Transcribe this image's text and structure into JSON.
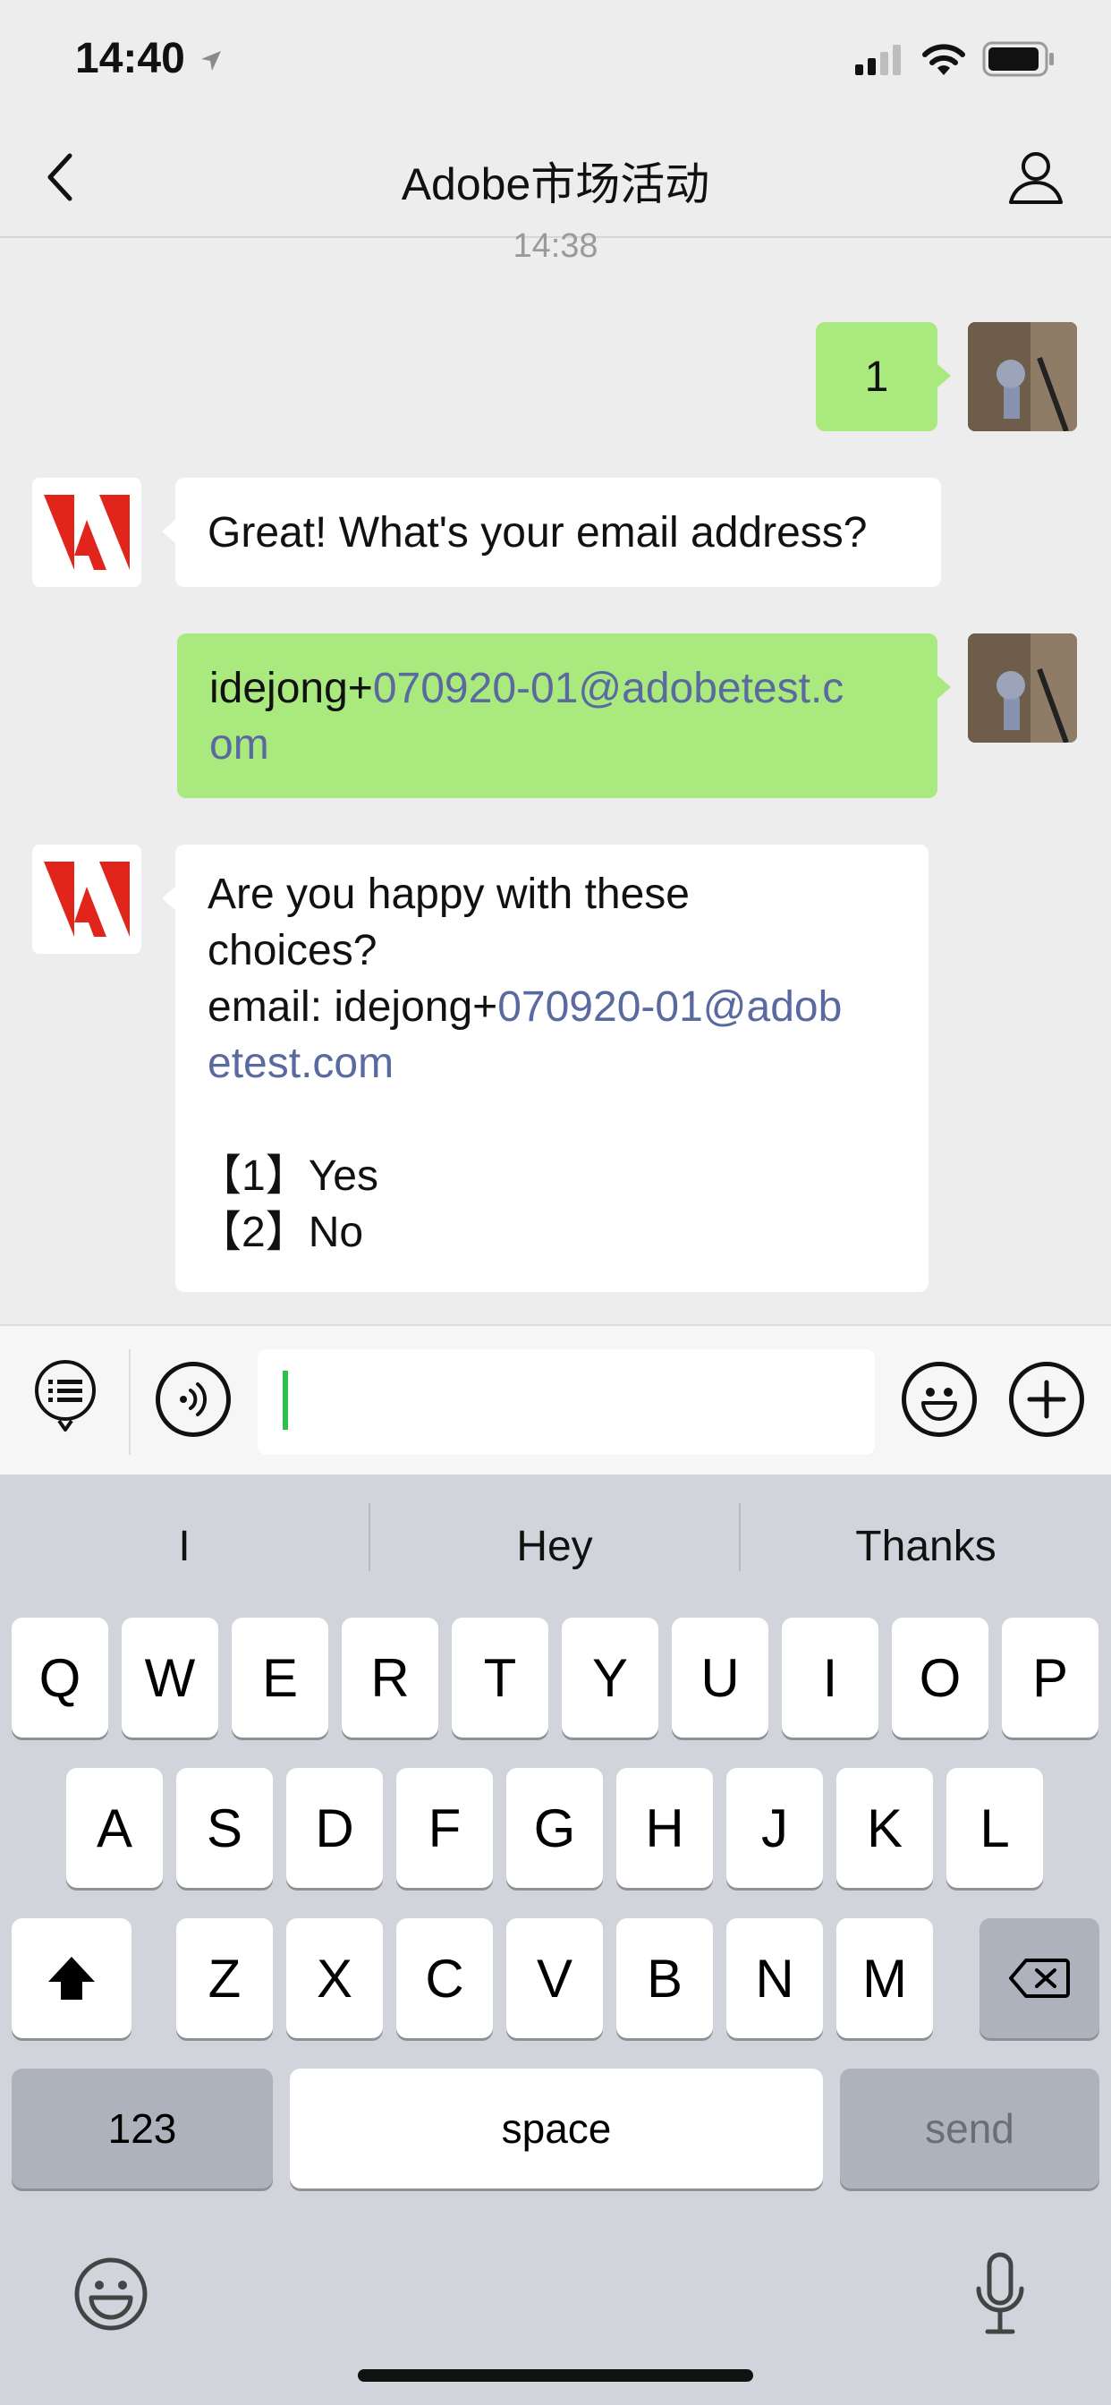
{
  "status_bar": {
    "time": "14:40"
  },
  "header": {
    "title": "Adobe市场活动"
  },
  "chat": {
    "timestamp": "14:38",
    "msg1": {
      "text": "1"
    },
    "msg2": {
      "text": "Great! What's your email address?"
    },
    "msg3": {
      "prefix": "idejong+",
      "link_line1": "070920-01@adobetest.c",
      "link_line2": "om"
    },
    "msg4": {
      "line1": "Are you happy with these",
      "line2": "choices?",
      "line3_prefix": "email: idejong+",
      "line3_link": "070920-01@adob",
      "line4_link": "etest.com",
      "option1": "【1】Yes",
      "option2": "【2】No"
    }
  },
  "input_bar": {
    "value": ""
  },
  "keyboard": {
    "suggestions": [
      "I",
      "Hey",
      "Thanks"
    ],
    "row1": [
      "Q",
      "W",
      "E",
      "R",
      "T",
      "Y",
      "U",
      "I",
      "O",
      "P"
    ],
    "row2": [
      "A",
      "S",
      "D",
      "F",
      "G",
      "H",
      "J",
      "K",
      "L"
    ],
    "row3": [
      "Z",
      "X",
      "C",
      "V",
      "B",
      "N",
      "M"
    ],
    "numbers_label": "123",
    "space_label": "space",
    "send_label": "send"
  },
  "colors": {
    "accent_green": "#a9e97d",
    "link": "#5a6aa0",
    "adobe_red": "#e1251b"
  }
}
